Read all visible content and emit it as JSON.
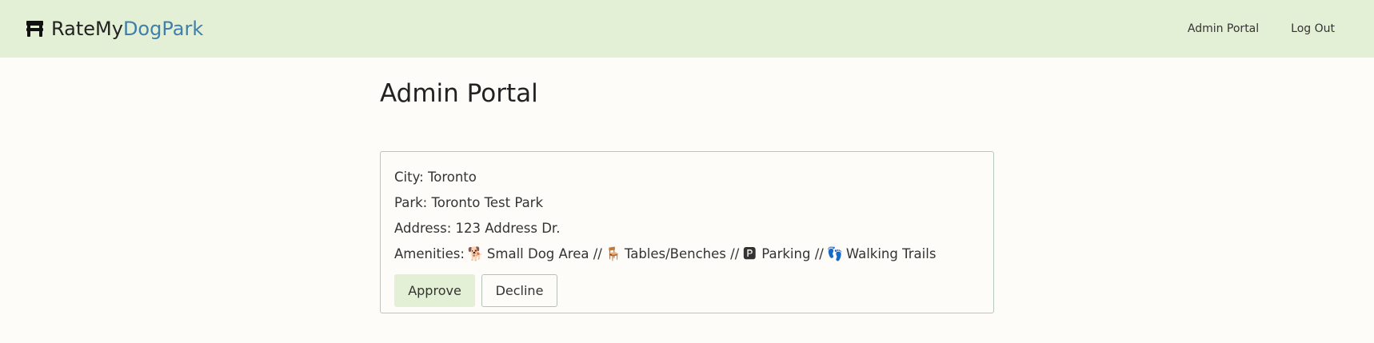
{
  "brand": {
    "name_part1": "Rate",
    "name_part2": "My",
    "name_accent": "DogPark"
  },
  "nav": {
    "admin_portal": "Admin Portal",
    "log_out": "Log Out"
  },
  "page": {
    "title": "Admin Portal"
  },
  "submission": {
    "city_label": "City:",
    "city": "Toronto",
    "park_label": "Park:",
    "park": "Toronto Test Park",
    "address_label": "Address:",
    "address": "123 Address Dr.",
    "amenities_label": "Amenities:",
    "amenities": [
      {
        "emoji": "🐕",
        "label": "Small Dog Area",
        "icon": "small-dog-icon"
      },
      {
        "emoji": "🪑",
        "label": "Tables/Benches",
        "icon": "bench-icon"
      },
      {
        "emoji": "🅿",
        "label": "Parking",
        "icon": "parking-icon"
      },
      {
        "emoji": "👣",
        "label": "Walking Trails",
        "icon": "footprints-icon"
      }
    ],
    "separator": "//"
  },
  "actions": {
    "approve": "Approve",
    "decline": "Decline"
  },
  "colors": {
    "navbar": "#e4f0d5",
    "brand_accent": "#3f7faa",
    "background": "#fefcf8",
    "card_border": "#b5c8bb"
  }
}
